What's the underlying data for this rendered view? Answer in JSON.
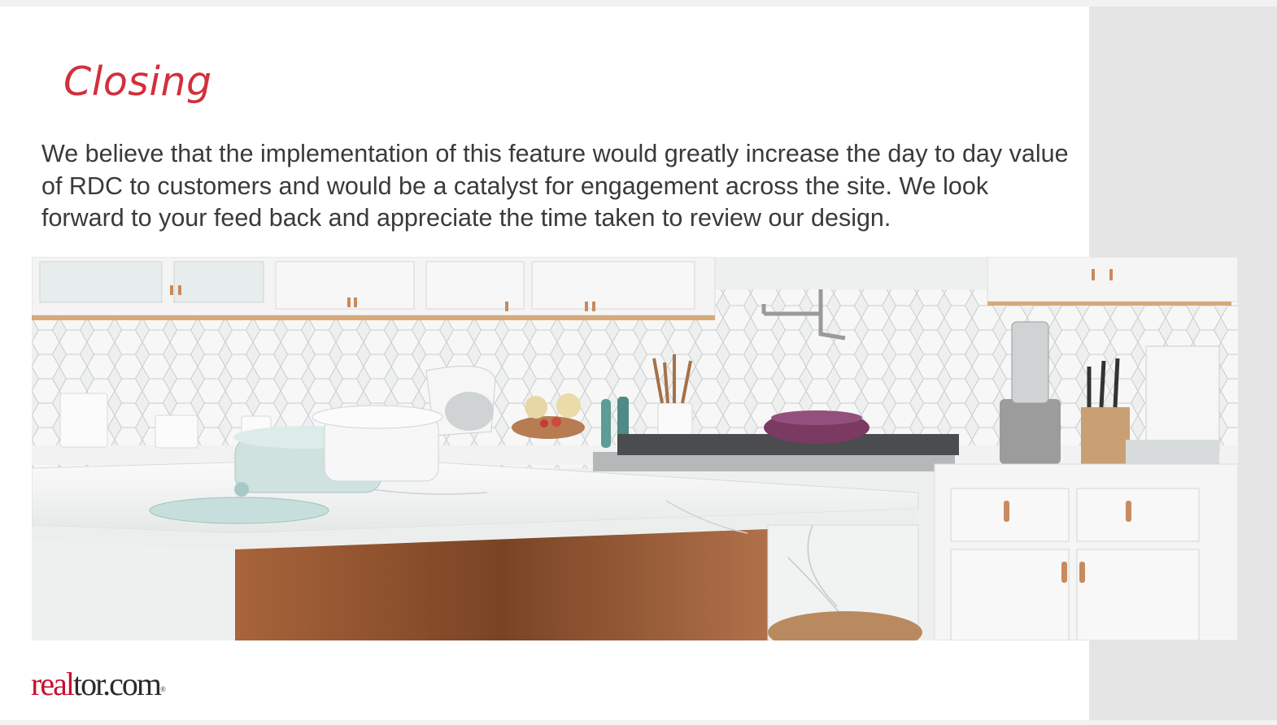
{
  "slide": {
    "title": "Closing",
    "body": "We believe that the implementation of this feature would greatly increase the day to day value of RDC to customers and would be a catalyst for engagement across the site. We look forward to your feed back and appreciate the time taken to review our design.",
    "logo": {
      "part1": "real",
      "part2": "tor.com",
      "mark": "®"
    }
  },
  "colors": {
    "title": "#d32f3c",
    "body_text": "#3a3a3a",
    "side_panel": "#e5e5e5",
    "logo_accent": "#c8102e"
  }
}
